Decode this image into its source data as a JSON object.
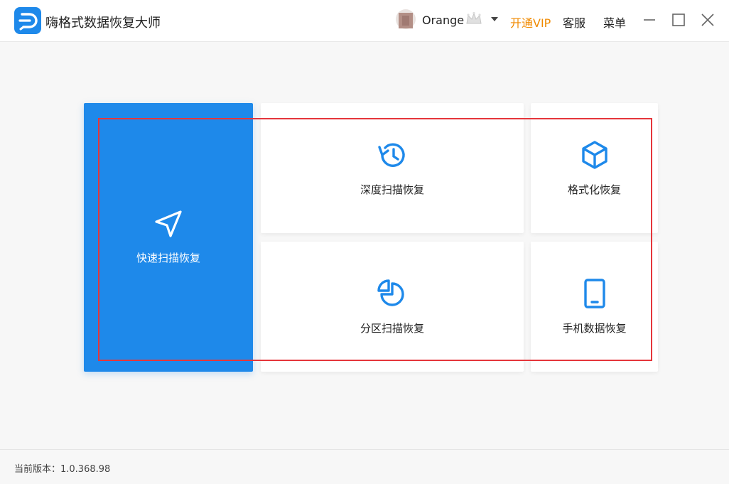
{
  "app": {
    "title": "嗨格式数据恢复大师",
    "logo_icon": "app-logo-d-icon",
    "accent_color": "#1e89ea"
  },
  "header": {
    "username": "Orange",
    "vip_label": "开通VIP",
    "vip_color": "#f08a00",
    "service_label": "客服",
    "menu_label": "菜单",
    "icons": [
      "avatar",
      "crown-icon",
      "caret-down-icon",
      "minimize-icon",
      "maximize-icon",
      "close-icon"
    ]
  },
  "modes": {
    "quick": {
      "label": "快速扫描恢复",
      "icon": "navigation-arrow-icon"
    },
    "deep": {
      "label": "深度扫描恢复",
      "icon": "history-clock-icon"
    },
    "format": {
      "label": "格式化恢复",
      "icon": "cube-icon"
    },
    "partition": {
      "label": "分区扫描恢复",
      "icon": "pie-chart-icon"
    },
    "phone": {
      "label": "手机数据恢复",
      "icon": "tablet-icon"
    }
  },
  "footer": {
    "version_text": "当前版本：1.0.368.98"
  }
}
